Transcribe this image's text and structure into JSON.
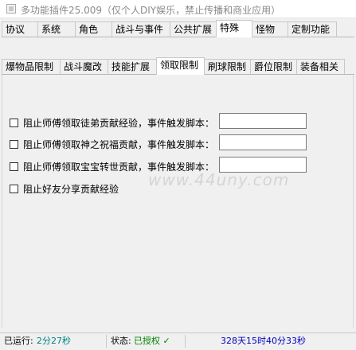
{
  "window": {
    "title": "多功能插件25.009（仅个人DIY娱乐，禁止传播和商业应用）"
  },
  "tabs_primary": [
    {
      "label": "协议"
    },
    {
      "label": "系统"
    },
    {
      "label": "角色"
    },
    {
      "label": "战斗与事件"
    },
    {
      "label": "公共扩展"
    },
    {
      "label": "特殊"
    },
    {
      "label": "怪物"
    },
    {
      "label": "定制功能"
    }
  ],
  "tabs_primary_active": "特殊",
  "tabs_secondary": [
    {
      "label": "爆物品限制"
    },
    {
      "label": "战斗魔改"
    },
    {
      "label": "技能扩展"
    },
    {
      "label": "领取限制"
    },
    {
      "label": "刷球限制"
    },
    {
      "label": "爵位限制"
    },
    {
      "label": "装备相关"
    }
  ],
  "tabs_secondary_active": "领取限制",
  "options": [
    {
      "label": "阻止师傅领取徒弟贡献经验，事件触发脚本：",
      "checked": false,
      "script": ""
    },
    {
      "label": "阻止师傅领取神之祝福贡献，事件触发脚本：",
      "checked": false,
      "script": ""
    },
    {
      "label": "阻止师傅领取宝宝转世贡献，事件触发脚本：",
      "checked": false,
      "script": ""
    },
    {
      "label": "阻止好友分享贡献经验",
      "checked": false
    }
  ],
  "watermark": "www.44uny.com",
  "status": {
    "runtime_label": "已运行:",
    "runtime_value": "2分27秒",
    "state_label": "状态:",
    "state_value": "已授权 ✓",
    "remaining": "328天15时40分33秒"
  },
  "colors": {
    "runtime": "#008080",
    "state": "#008000",
    "remaining": "#0000c0"
  }
}
